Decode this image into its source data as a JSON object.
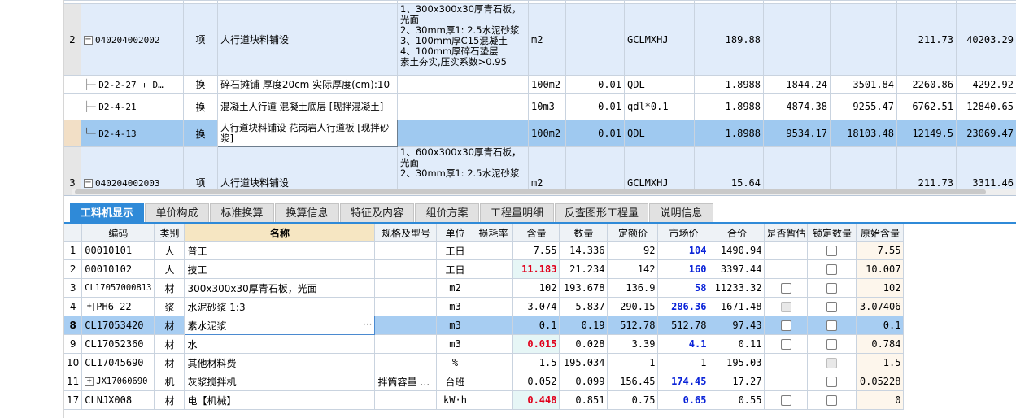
{
  "upper": {
    "rows": [
      {
        "num": "",
        "code": "",
        "type": "",
        "name": "",
        "features": "",
        "unit": "",
        "qty": "",
        "formula": "",
        "q2": "",
        "p1": "",
        "p2": "",
        "p3": "",
        "p4": ""
      },
      {
        "num": "2",
        "code": "040204002002",
        "type": "项",
        "name": "人行道块料铺设",
        "features": "1、300x300x30厚青石板，光面\n2、30mm厚1: 2.5水泥砂浆\n3、100mm厚C15混凝土\n4、100mm厚碎石垫层\n素土夯实,压实系数>0.95",
        "unit": "m2",
        "qty": "",
        "formula": "GCLMXHJ",
        "q2": "189.88",
        "p1": "",
        "p2": "",
        "p3": "211.73",
        "p4": "40203.29"
      },
      {
        "num": "",
        "code": "D2-2-27 + D…",
        "type": "换",
        "name": "碎石摊铺 厚度20cm  实际厚度(cm):10",
        "features": "",
        "unit": "100m2",
        "qty": "0.01",
        "formula": "QDL",
        "q2": "1.8988",
        "p1": "1844.24",
        "p2": "3501.84",
        "p3": "2260.86",
        "p4": "4292.92"
      },
      {
        "num": "",
        "code": "D2-4-21",
        "type": "换",
        "name": "混凝土人行道 混凝土底层  [现拌混凝土]",
        "features": "",
        "unit": "10m3",
        "qty": "0.01",
        "formula": "qdl*0.1",
        "q2": "1.8988",
        "p1": "4874.38",
        "p2": "9255.47",
        "p3": "6762.51",
        "p4": "12840.65"
      },
      {
        "num": "",
        "code": "D2-4-13",
        "type": "换",
        "name": "人行道块料铺设 花岗岩人行道板  [现拌砂浆]",
        "features": "",
        "unit": "100m2",
        "qty": "0.01",
        "formula": "QDL",
        "q2": "1.8988",
        "p1": "9534.17",
        "p2": "18103.48",
        "p3": "12149.5",
        "p4": "23069.47"
      },
      {
        "num": "3",
        "code": "040204002003",
        "type": "项",
        "name": "人行道块料铺设",
        "features": "1、600x300x30厚青石板，光面\n2、30mm厚1: 2.5水泥砂浆",
        "unit": "m2",
        "qty": "",
        "formula": "GCLMXHJ",
        "q2": "15.64",
        "p1": "",
        "p2": "",
        "p3": "211.73",
        "p4": "3311.46"
      }
    ]
  },
  "tabs": [
    "工料机显示",
    "单价构成",
    "标准换算",
    "换算信息",
    "特征及内容",
    "组价方案",
    "工程量明细",
    "反查图形工程量",
    "说明信息"
  ],
  "lower": {
    "headers": [
      "",
      "编码",
      "类别",
      "名称",
      "规格及型号",
      "单位",
      "损耗率",
      "含量",
      "数量",
      "定额价",
      "市场价",
      "合价",
      "是否暂估",
      "锁定数量",
      "原始含量"
    ],
    "rows": [
      {
        "idx": "1",
        "code": "00010101",
        "cat": "人",
        "name": "普工",
        "spec": "",
        "unit": "工日",
        "loss": "",
        "content": "7.55",
        "qty": "14.336",
        "quota": "92",
        "market": "104",
        "total": "1490.94",
        "orig": "7.55"
      },
      {
        "idx": "2",
        "code": "00010102",
        "cat": "人",
        "name": "技工",
        "spec": "",
        "unit": "工日",
        "loss": "",
        "content": "11.183",
        "qty": "21.234",
        "quota": "142",
        "market": "160",
        "total": "3397.44",
        "orig": "10.007"
      },
      {
        "idx": "3",
        "code": "CL17057000813",
        "cat": "材",
        "name": "300x300x30厚青石板，光面",
        "spec": "",
        "unit": "m2",
        "loss": "",
        "content": "102",
        "qty": "193.678",
        "quota": "136.9",
        "market": "58",
        "total": "11233.32",
        "orig": "102"
      },
      {
        "idx": "4",
        "code": "PH6-22",
        "cat": "浆",
        "name": "水泥砂浆 1:3",
        "spec": "",
        "unit": "m3",
        "loss": "",
        "content": "3.074",
        "qty": "5.837",
        "quota": "290.15",
        "market": "286.36",
        "total": "1671.48",
        "orig": "3.07406"
      },
      {
        "idx": "8",
        "code": "CL17053420",
        "cat": "材",
        "name": "素水泥浆",
        "spec": "",
        "unit": "m3",
        "loss": "",
        "content": "0.1",
        "qty": "0.19",
        "quota": "512.78",
        "market": "512.78",
        "total": "97.43",
        "orig": "0.1"
      },
      {
        "idx": "9",
        "code": "CL17052360",
        "cat": "材",
        "name": "水",
        "spec": "",
        "unit": "m3",
        "loss": "",
        "content": "0.015",
        "qty": "0.028",
        "quota": "3.39",
        "market": "4.1",
        "total": "0.11",
        "orig": "0.784"
      },
      {
        "idx": "10",
        "code": "CL17045690",
        "cat": "材",
        "name": "其他材料费",
        "spec": "",
        "unit": "%",
        "loss": "",
        "content": "1.5",
        "qty": "195.034",
        "quota": "1",
        "market": "1",
        "total": "195.03",
        "orig": "1.5"
      },
      {
        "idx": "11",
        "code": "JX17060690",
        "cat": "机",
        "name": "灰浆搅拌机",
        "spec": "拌筒容量 …",
        "unit": "台班",
        "loss": "",
        "content": "0.052",
        "qty": "0.099",
        "quota": "156.45",
        "market": "174.45",
        "total": "17.27",
        "orig": "0.05228"
      },
      {
        "idx": "17",
        "code": "CLNJX008",
        "cat": "材",
        "name": "电【机械】",
        "spec": "",
        "unit": "kW·h",
        "loss": "",
        "content": "0.448",
        "qty": "0.851",
        "quota": "0.75",
        "market": "0.65",
        "total": "0.55",
        "orig": "0"
      }
    ]
  },
  "icons": {
    "expand": "+",
    "collapse": "−",
    "ellipsis": "···"
  },
  "colors": {
    "tab_active": "#2f8ad8",
    "selected_row": "#9fc9f0",
    "red_value": "#e0001b",
    "blue_value": "#0a23d8"
  }
}
